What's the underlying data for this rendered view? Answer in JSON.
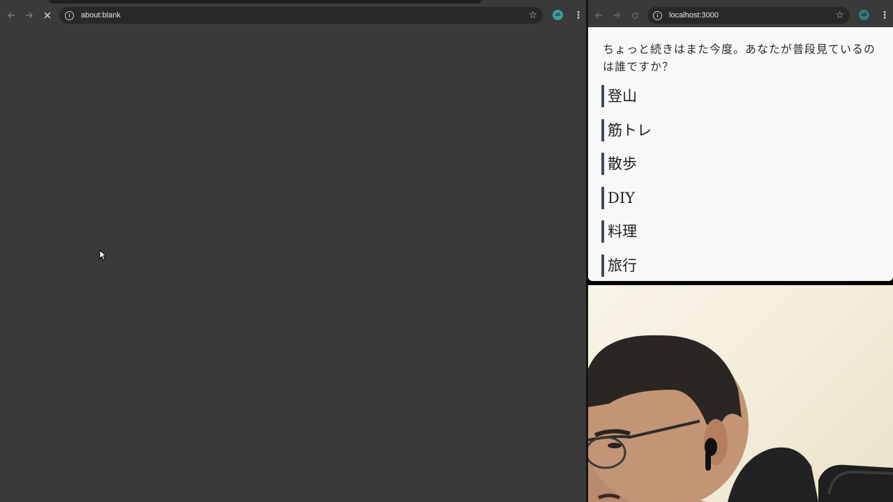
{
  "left_browser": {
    "url": "about:blank",
    "loading": true
  },
  "right_browser": {
    "url": "localhost:3000",
    "question": "ちょっと続きはまた今度。あなたが普段見ているのは誰ですか？",
    "topics": [
      {
        "label": "登山"
      },
      {
        "label": "筋トレ"
      },
      {
        "label": "散歩"
      },
      {
        "label": "DIY"
      },
      {
        "label": "料理"
      },
      {
        "label": "旅行"
      }
    ]
  },
  "profile": {
    "initials": "ab"
  },
  "icons": {
    "back": "back-arrow-icon",
    "forward": "forward-arrow-icon",
    "stop": "close-icon",
    "reload": "reload-icon",
    "info": "info-icon",
    "bookmark": "star-icon",
    "menu": "kebab-menu-icon"
  },
  "colors": {
    "browser_chrome": "#3a3a3a",
    "omnibox": "#282828",
    "page_background": "#f8f8f8",
    "topic_accent": "#3d4a5c",
    "avatar": "#3aa39a"
  }
}
